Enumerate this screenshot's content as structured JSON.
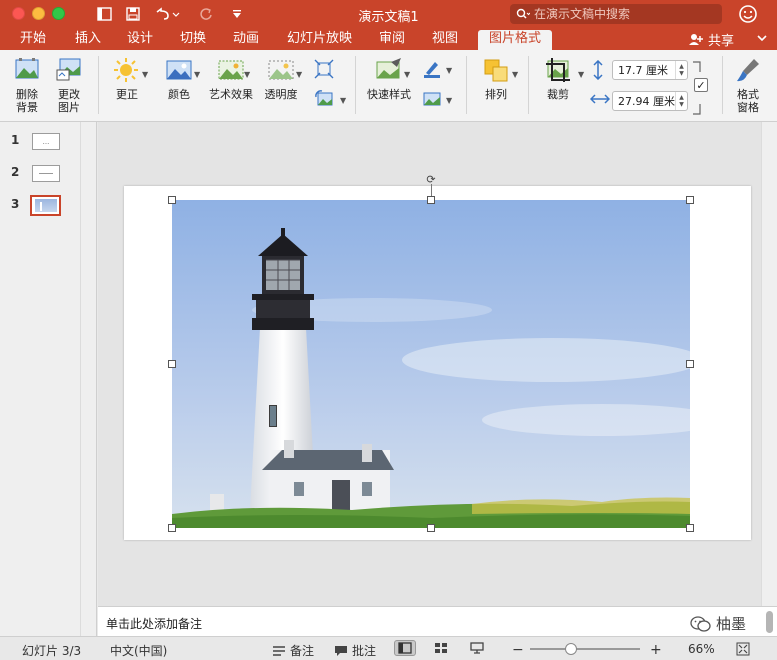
{
  "window": {
    "title": "演示文稿1",
    "search_placeholder": "在演示文稿中搜索"
  },
  "tabs": [
    {
      "label": "开始"
    },
    {
      "label": "插入"
    },
    {
      "label": "设计"
    },
    {
      "label": "切换"
    },
    {
      "label": "动画"
    },
    {
      "label": "幻灯片放映"
    },
    {
      "label": "审阅"
    },
    {
      "label": "视图"
    },
    {
      "label": "图片格式",
      "active": true
    }
  ],
  "share_label": "共享",
  "ribbon": {
    "remove_bg_line1": "删除",
    "remove_bg_line2": "背景",
    "change_pic_line1": "更改",
    "change_pic_line2": "图片",
    "corrections": "更正",
    "color": "颜色",
    "artistic": "艺术效果",
    "transparency": "透明度",
    "quick_styles": "快速样式",
    "arrange": "排列",
    "crop": "裁剪",
    "height_value": "17.7 厘米",
    "width_value": "27.94 厘米",
    "format_pane_line1": "格式",
    "format_pane_line2": "窗格"
  },
  "slides": [
    {
      "num": "1",
      "preview": "..."
    },
    {
      "num": "2",
      "preview": ""
    },
    {
      "num": "3",
      "preview": ""
    }
  ],
  "notes_placeholder": "单击此处添加备注",
  "watermark_text": "柚墨",
  "status": {
    "slide_info": "幻灯片 3/3",
    "language": "中文(中国)",
    "notes": "备注",
    "comments": "批注",
    "zoom": "66%"
  },
  "colors": {
    "accent": "#c9442a",
    "ribbon_bg": "#f3f3f3"
  }
}
